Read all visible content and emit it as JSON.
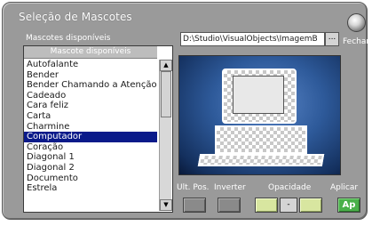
{
  "window": {
    "title": "Seleção de Mascotes",
    "close_label": "Fechar"
  },
  "list": {
    "label": "Mascotes disponíveis",
    "header": "Mascote disponíveis",
    "items": [
      "Autofalante",
      "Bender",
      "Bender Chamando a Atenção",
      "Cadeado",
      "Cara feliz",
      "Carta",
      "Charmine",
      "Computador",
      "Coração",
      "Diagonal 1",
      "Diagonal 2",
      "Documento",
      "Estrela"
    ],
    "selected_index": 7
  },
  "path": {
    "value": "D:\\Studio\\VisualObjects\\ImagemB",
    "browse_label": "..."
  },
  "controls": {
    "ult_pos_label": "Ult. Pos.",
    "inverter_label": "Inverter",
    "opacidade_label": "Opacidade",
    "opacidade_minus": "-",
    "aplicar_label": "Aplicar",
    "aplicar_button": "Ap"
  },
  "icons": {
    "close": "round-knob-icon",
    "scroll_up": "arrow-up-icon",
    "scroll_down": "arrow-down-icon",
    "preview": "computer-mascot-icon"
  },
  "colors": {
    "dialog_bg": "#9a9a9a",
    "selection_bg": "#0a1a8a",
    "apply_button": "#4ab04a",
    "opacity_button": "#d8e6a0"
  }
}
